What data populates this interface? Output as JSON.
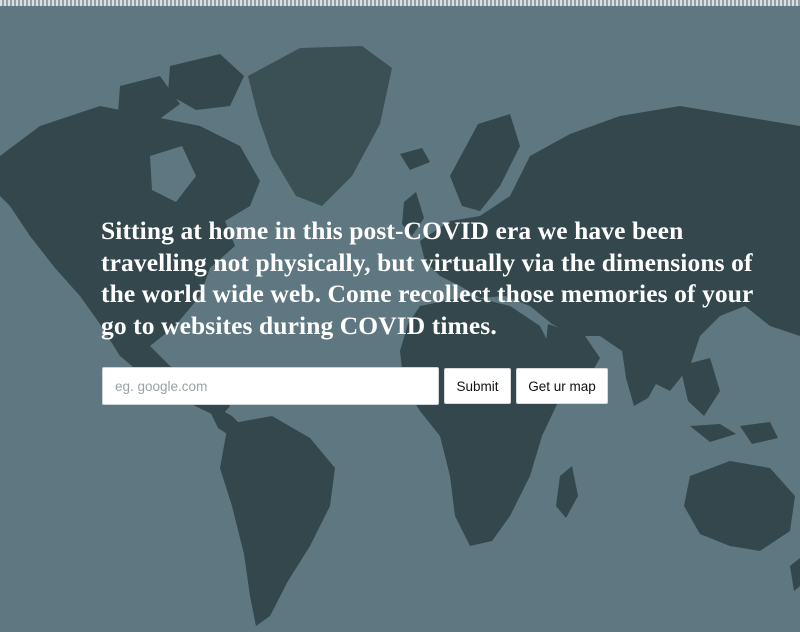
{
  "hero": {
    "text": "Sitting at home in this post-COVID era we have been travelling not physically, but virtually via the dimensions of the world wide web. Come recollect those memories of your go to websites during COVID times."
  },
  "form": {
    "url_placeholder": "eg. google.com",
    "url_value": "",
    "submit_label": "Submit",
    "map_label": "Get ur map"
  },
  "background": {
    "image": "world-map",
    "base_color": "#5f7780",
    "land_color": "#33474c"
  }
}
